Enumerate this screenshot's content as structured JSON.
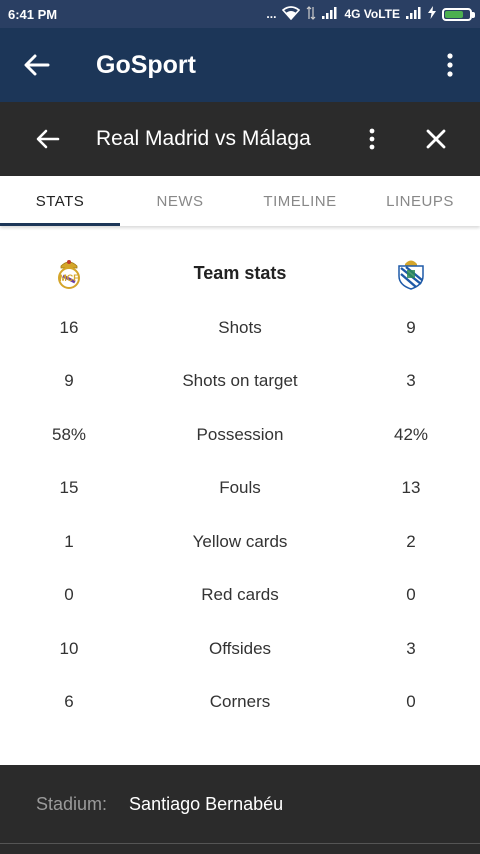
{
  "status_bar": {
    "time": "6:41 PM",
    "dots": "...",
    "network": "4G VoLTE"
  },
  "app_bar": {
    "title": "GoSport"
  },
  "match": {
    "title": "Real Madrid vs Málaga"
  },
  "tabs": [
    {
      "label": "STATS",
      "active": true
    },
    {
      "label": "NEWS",
      "active": false
    },
    {
      "label": "TIMELINE",
      "active": false
    },
    {
      "label": "LINEUPS",
      "active": false
    }
  ],
  "stats": {
    "header": "Team stats",
    "home_crest": "real-madrid-crest-icon",
    "away_crest": "malaga-crest-icon",
    "rows": [
      {
        "label": "Shots",
        "home": "16",
        "away": "9"
      },
      {
        "label": "Shots on target",
        "home": "9",
        "away": "3"
      },
      {
        "label": "Possession",
        "home": "58%",
        "away": "42%"
      },
      {
        "label": "Fouls",
        "home": "15",
        "away": "13"
      },
      {
        "label": "Yellow cards",
        "home": "1",
        "away": "2"
      },
      {
        "label": "Red cards",
        "home": "0",
        "away": "0"
      },
      {
        "label": "Offsides",
        "home": "10",
        "away": "3"
      },
      {
        "label": "Corners",
        "home": "6",
        "away": "0"
      }
    ]
  },
  "stadium": {
    "label": "Stadium:",
    "value": "Santiago Bernabéu"
  },
  "colors": {
    "status_bar": "#2a3f63",
    "app_bar": "#1c3658",
    "dark_header": "#2b2b2b"
  }
}
